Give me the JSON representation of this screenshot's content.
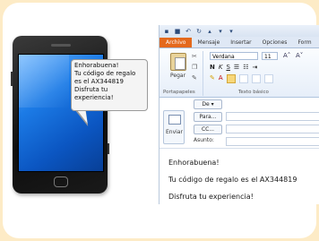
{
  "bubble": {
    "lines": [
      "Enhorabuena!",
      " Tu código de regalo",
      "es el AX344819",
      " Disfruta tu",
      "experiencia!"
    ]
  },
  "outlook": {
    "tabs": [
      "Archivo",
      "Mensaje",
      "Insertar",
      "Opciones",
      "Form"
    ],
    "ribbon": {
      "paste_label": "Pegar",
      "clipboard_group": "Portapapeles",
      "font_name": "Verdana",
      "font_size": "11",
      "text_group": "Texto básico"
    },
    "header": {
      "send_label": "Enviar",
      "from_label": "De",
      "to_label": "Para...",
      "cc_label": "CC...",
      "subject_label": "Asunto:"
    },
    "body_lines": [
      "Enhorabuena!",
      "Tu código de regalo es el AX344819",
      "Disfruta tu experiencia!"
    ]
  },
  "colors": {
    "background": "#fdebc6",
    "file_tab": "#e4691c",
    "screen": "#1c7be6"
  }
}
